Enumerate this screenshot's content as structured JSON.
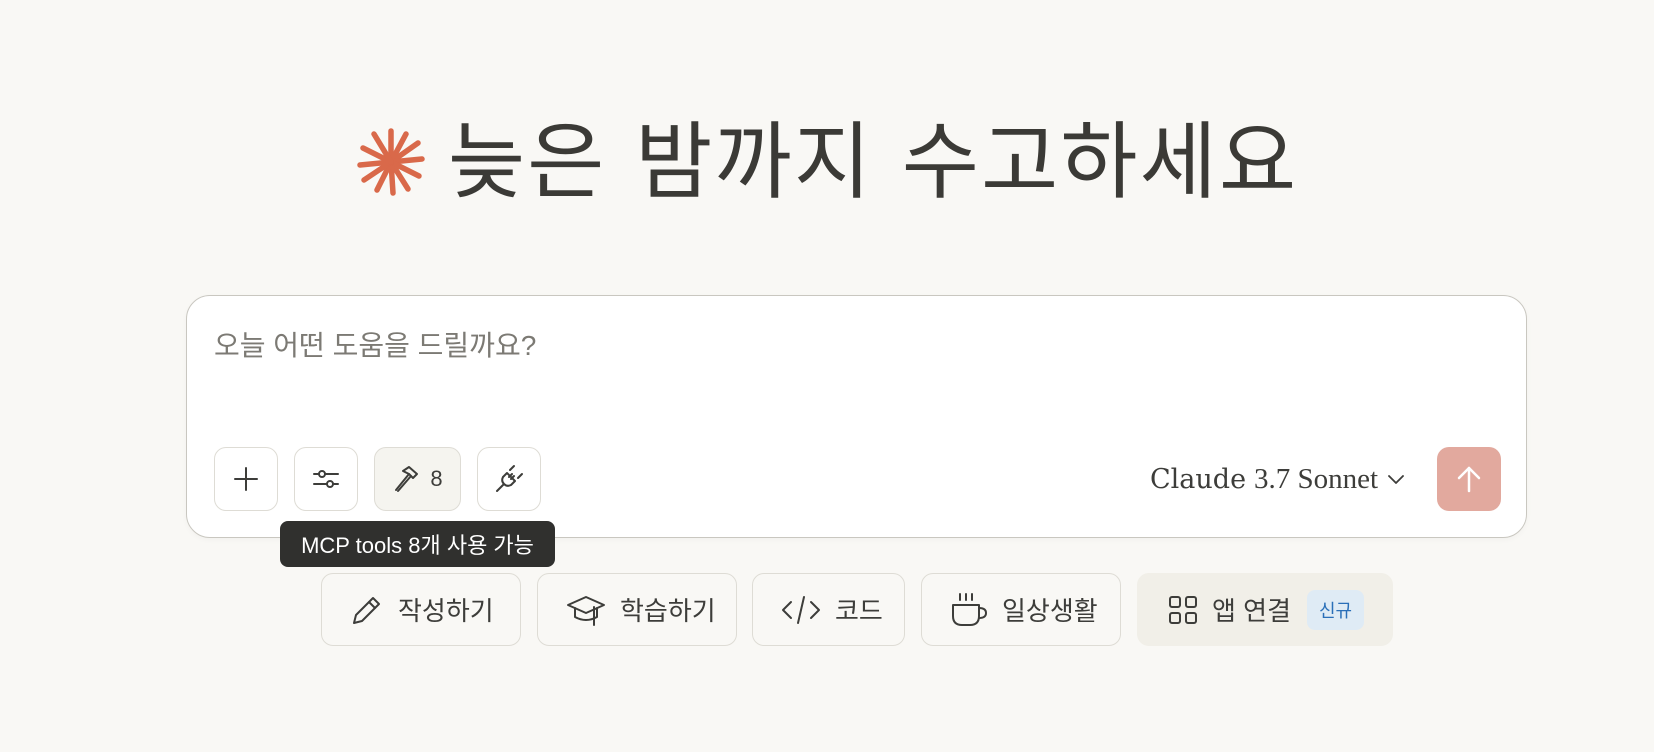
{
  "greeting": {
    "text": "늦은 밤까지 수고하세요",
    "logo_color": "#d9694a"
  },
  "composer": {
    "placeholder": "오늘 어떤 도움을 드릴까요?",
    "value": "",
    "add_button_icon": "plus-icon",
    "settings_button_icon": "sliders-icon",
    "tools_button_icon": "hammer-icon",
    "tools_count": "8",
    "connect_button_icon": "plug-icon",
    "tooltip": "MCP tools 8개 사용 가능",
    "model": {
      "name": "Claude",
      "version": "3.7 Sonnet",
      "icon": "chevron-down-icon"
    },
    "send_button_icon": "arrow-up-icon",
    "send_button_color": "#e2a99e"
  },
  "suggestions": [
    {
      "label": "작성하기",
      "icon": "pencil-icon"
    },
    {
      "label": "학습하기",
      "icon": "graduation-cap-icon"
    },
    {
      "label": "코드",
      "icon": "code-icon"
    },
    {
      "label": "일상생활",
      "icon": "coffee-cup-icon"
    },
    {
      "label": "앱 연결",
      "icon": "grid-icon",
      "badge": "신규"
    }
  ],
  "colors": {
    "background": "#f9f8f5",
    "accent": "#d9694a",
    "badge_bg": "#dfebf5",
    "badge_text": "#2a6fb8"
  }
}
